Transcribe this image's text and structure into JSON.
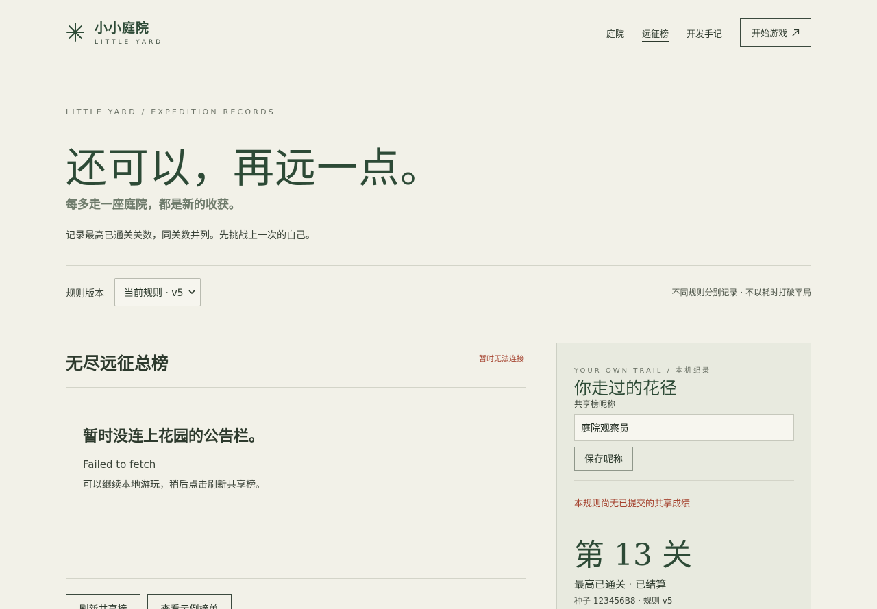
{
  "header": {
    "brand_cn": "小小庭院",
    "brand_en": "LITTLE YARD",
    "nav": [
      "庭院",
      "远征榜",
      "开发手记"
    ],
    "active_nav": "远征榜",
    "cta_label": "开始游戏",
    "cta_icon": "arrow-up-right-icon"
  },
  "hero": {
    "eyebrow": "LITTLE YARD / EXPEDITION RECORDS",
    "headline": "还可以，再远一点。",
    "subtitle": "每多走一座庭院，都是新的收获。",
    "description": "记录最高已通关关数，同关数并列。先挑战上一次的自己。"
  },
  "version": {
    "label": "规则版本",
    "selected": "当前规则 · v5",
    "note": "不同规则分别记录 · 不以耗时打破平局"
  },
  "board": {
    "title": "无尽远征总榜",
    "status": "暂时无法连接",
    "error_title": "暂时没连上花园的公告栏。",
    "error_code": "Failed to fetch",
    "error_hint": "可以继续本地游玩，稍后点击刷新共享榜。",
    "refresh_label": "刷新共享榜",
    "sample_label": "查看示例榜单"
  },
  "panel": {
    "eyebrow": "YOUR OWN TRAIL / 本机纪录",
    "title": "你走过的花径",
    "nickname_label": "共享榜昵称",
    "nickname_value": "庭院观察员",
    "save_label": "保存昵称",
    "warning": "本规则尚无已提交的共享成绩",
    "level": "第 13 关",
    "best": "最高已通关 · 已结算",
    "seed": "种子 123456B8 · 规则 v5"
  },
  "colors": {
    "background": "#f2f1e8",
    "brand_green": "#2d4a36",
    "panel_bg": "#e8eadf",
    "warning_red": "#a5432f"
  }
}
